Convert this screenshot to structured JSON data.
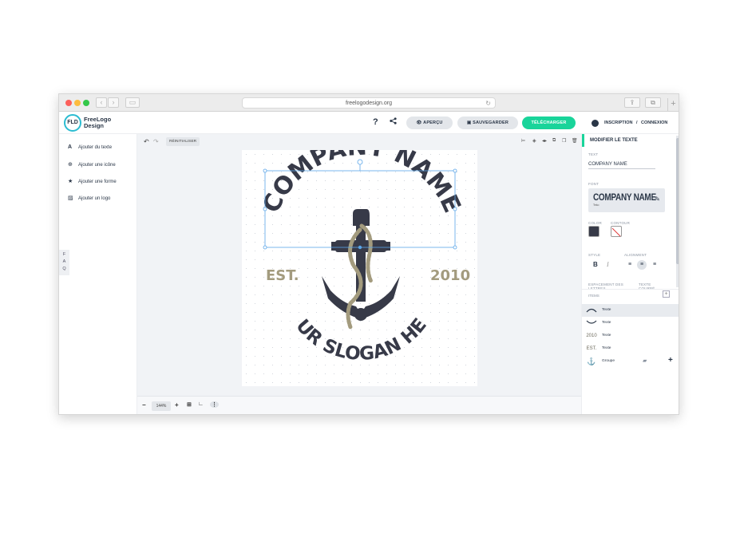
{
  "browser": {
    "url": "freelogodesign.org",
    "traffic_colors": [
      "#fc605b",
      "#fdbc40",
      "#34c84a"
    ]
  },
  "header": {
    "logo_mark": "FLD",
    "logo_line1": "FreeLogo",
    "logo_line2": "Design",
    "help_label": "?",
    "preview_label": "APERÇU",
    "save_label": "SAUVEGARDER",
    "download_label": "TÉLÉCHARGER",
    "register_label": "INSCRIPTION",
    "auth_separator": "/",
    "login_label": "CONNEXION"
  },
  "sidebar": {
    "items": [
      {
        "icon": "text-icon",
        "label": "Ajouter du texte"
      },
      {
        "icon": "globe-icon",
        "label": "Ajouter une icône"
      },
      {
        "icon": "star-icon",
        "label": "Ajouter une forme"
      },
      {
        "icon": "image-icon",
        "label": "Ajouter un logo"
      }
    ],
    "faq": [
      "F",
      "A",
      "Q"
    ]
  },
  "canvas": {
    "reset_label": "RÉINITIALISER",
    "zoom": "144%",
    "logo": {
      "company": "COMPANY NAME",
      "slogan": "YOUR SLOGAN HERE",
      "est": "EST.",
      "year": "2010",
      "color_dark": "#373a48",
      "color_accent": "#a39b7e"
    }
  },
  "panel": {
    "title": "MODIFIER LE TEXTE",
    "text_label": "TEXT",
    "text_value": "COMPANY NAME",
    "font_label": "FONT",
    "font_name": "COMPANY NAME",
    "font_sub": "Teko",
    "color_label": "COLOR",
    "contour_label": "CONTOUR",
    "color_value": "#373a48",
    "style_label": "STYLE",
    "alignment_label": "ALIGNMENT",
    "bold_label": "B",
    "italic_label": "I",
    "spacing_label": "ESPACEMENT DES LETTRES",
    "curve_label": "TEXTE COURBÉ",
    "items_label": "ITEMS",
    "items": [
      {
        "thumb": "arc-up",
        "label": "Texte"
      },
      {
        "thumb": "arc-down",
        "label": "Texte"
      },
      {
        "thumb": "2010",
        "label": "Texte"
      },
      {
        "thumb": "EST.",
        "label": "Texte"
      },
      {
        "thumb": "anchor-icon",
        "label": "Groupe"
      }
    ]
  }
}
